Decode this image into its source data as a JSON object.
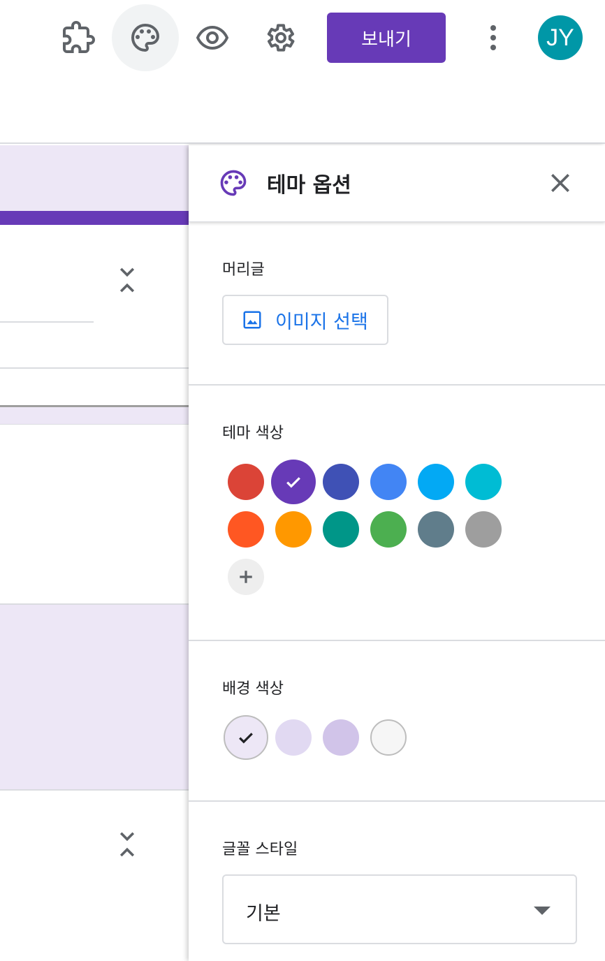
{
  "toolbar": {
    "icons": [
      "puzzle-icon",
      "palette-icon",
      "eye-icon",
      "gear-icon",
      "more-vert-icon"
    ],
    "send_label": "보내기",
    "avatar_initials": "JY",
    "avatar_color": "#0097a7",
    "accent": "#673ab7"
  },
  "theme_panel": {
    "title": "테마 옵션",
    "header_section": {
      "label": "머리글",
      "image_button_label": "이미지 선택"
    },
    "theme_color": {
      "label": "테마 색상",
      "colors": [
        "#db4437",
        "#673ab7",
        "#3f51b5",
        "#4285f4",
        "#03a9f4",
        "#00bcd4",
        "#ff5722",
        "#ff9800",
        "#009688",
        "#4caf50",
        "#607d8b",
        "#9e9e9e"
      ],
      "selected": "#673ab7",
      "add_custom_icon": "plus-icon"
    },
    "background_color": {
      "label": "배경 색상",
      "colors": [
        "#ede7f6",
        "#e1d9f2",
        "#d1c4e9",
        "#f6f6f6"
      ],
      "selected": "#ede7f6"
    },
    "font_style": {
      "label": "글꼴 스타일",
      "value": "기본"
    }
  }
}
